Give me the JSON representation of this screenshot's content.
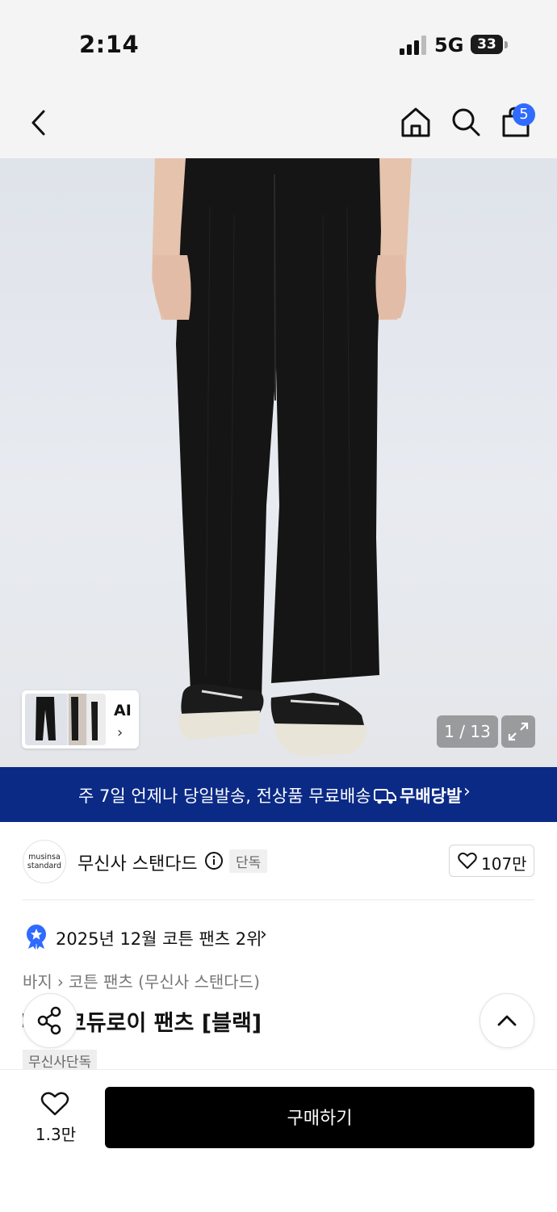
{
  "status_bar": {
    "time": "2:14",
    "network": "5G",
    "battery": "33"
  },
  "header": {
    "cart_count": "5"
  },
  "product_image": {
    "image_counter": "1 / 13",
    "ai_label": "AI"
  },
  "delivery_banner": {
    "text": "주 7일 언제나 당일발송, 전상품 무료배송",
    "logo_text": "무배당발"
  },
  "brand": {
    "logo_line1": "musinsa",
    "logo_line2": "standard",
    "name": "무신사 스탠다드",
    "exclusive_tag": "단독",
    "like_count": "107만"
  },
  "ranking": {
    "text": "2025년 12월 코튼 팬츠 2위"
  },
  "breadcrumb": {
    "items": [
      "바지",
      "코튼 팬츠 (무신사 스탠다드)"
    ]
  },
  "product": {
    "title": "와이드 코듀로이 팬츠 [블랙]",
    "tag": "무신사단독"
  },
  "bottom_bar": {
    "wish_count": "1.3만",
    "buy_label": "구매하기"
  },
  "colors": {
    "accent_blue": "#2f6bff",
    "banner_navy": "#0b2a86",
    "buy_button": "#000000"
  },
  "icons": [
    "signal-icon",
    "back-arrow-icon",
    "home-icon",
    "search-icon",
    "shopping-bag-icon",
    "expand-icon",
    "info-icon",
    "heart-icon",
    "ranking-badge-icon",
    "share-icon",
    "chevron-up-icon"
  ]
}
